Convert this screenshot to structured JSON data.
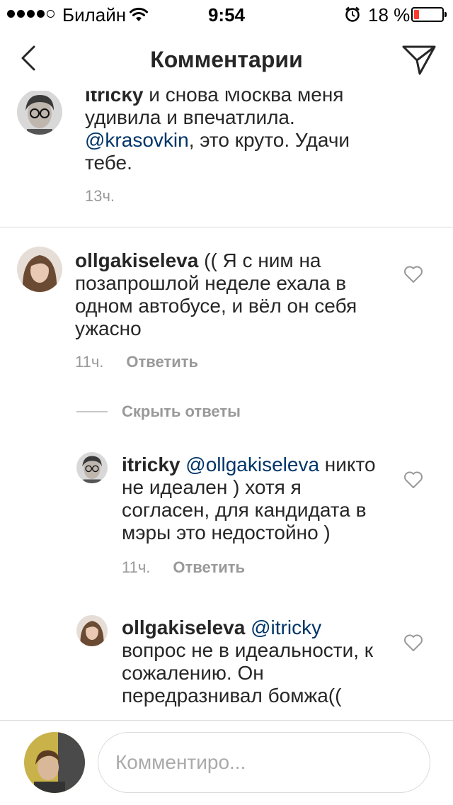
{
  "status_bar": {
    "carrier": "Билайн",
    "time": "9:54",
    "battery_percent": "18 %",
    "battery_level": 0.18,
    "battery_color": "#ff3b30",
    "signal_bars": 4,
    "icons": [
      "wifi-icon",
      "alarm-icon",
      "battery-icon"
    ]
  },
  "nav": {
    "title": "Комментарии",
    "back_icon": "chevron-left-icon",
    "send_icon": "paper-plane-icon"
  },
  "comments": [
    {
      "username": "itricky",
      "text_before": " и снова Москва меня удивила и впечатлила. ",
      "mention": "@krasovkin",
      "text_after": ", это круто. Удачи тебе.",
      "time": "13ч."
    },
    {
      "username": "ollgakiseleva",
      "text": " (( Я с ним на позапрошлой неделе ехала в одном автобусе, и вёл он себя ужасно",
      "time": "11ч.",
      "reply_label": "Ответить",
      "hide_replies_label": "Скрыть ответы",
      "replies": [
        {
          "username": "itricky",
          "mention": "@ollgakiseleva",
          "text": " никто не идеален ) хотя я согласен, для кандидата в мэры это недостойно )",
          "time": "11ч.",
          "reply_label": "Ответить"
        },
        {
          "username": "ollgakiseleva",
          "mention": "@itricky",
          "text": " вопрос не в идеальности, к сожалению. Он передразнивал бомжа(("
        }
      ]
    }
  ],
  "composer": {
    "placeholder": "Комментиро..."
  },
  "colors": {
    "text": "#262626",
    "mention": "#003569",
    "meta": "#999999",
    "divider": "#dbdbdb"
  }
}
